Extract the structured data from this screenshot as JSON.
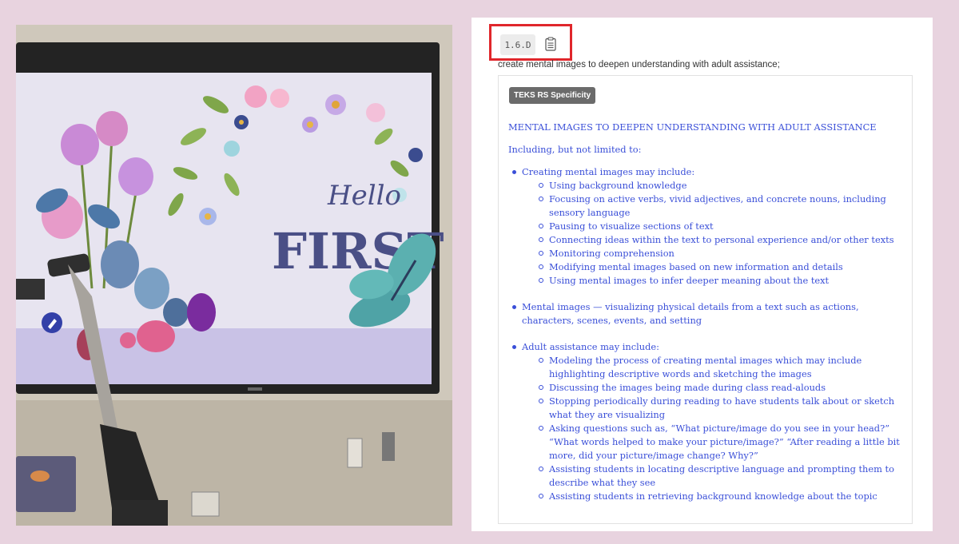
{
  "photo": {
    "screen_greeting": "Hello",
    "screen_title": "FIRST"
  },
  "panel": {
    "standard_code": "1.6.D",
    "copy_icon": "clipboard-icon",
    "description": "create mental images to deepen understanding with adult assistance;",
    "badge": "TEKS RS Specificity",
    "heading": "MENTAL IMAGES TO DEEPEN UNDERSTANDING WITH ADULT ASSISTANCE",
    "intro": "Including, but not limited to:",
    "sections": [
      {
        "label": "Creating mental images may include:",
        "items": [
          "Using background knowledge",
          "Focusing on active verbs, vivid adjectives, and concrete nouns, including sensory language",
          "Pausing to visualize sections of text",
          "Connecting ideas within the text to personal experience and/or other texts",
          "Monitoring comprehension",
          "Modifying mental images based on new information and details",
          "Using mental images to infer deeper meaning about the text"
        ]
      },
      {
        "label": "Mental images — visualizing physical details from a text such as actions, characters, scenes, events, and setting",
        "items": []
      },
      {
        "label": "Adult assistance may include:",
        "items": [
          "Modeling the process of creating mental images which may include highlighting descriptive words and sketching the images",
          "Discussing the images being made during class read-alouds",
          "Stopping periodically during reading to have students talk about or sketch what they are visualizing",
          "Asking questions such as, “What picture/image do you see in your head?” “What words helped to make your picture/image?” “After reading a little bit more, did your picture/image change? Why?”",
          "Assisting students in locating descriptive language and prompting them to describe what they see",
          "Assisting students in retrieving background knowledge about the topic"
        ]
      }
    ]
  },
  "colors": {
    "background": "#e8d3df",
    "link_text": "#3a4fd8",
    "highlight_box": "#e0262b",
    "badge_bg": "#6b6b6b"
  }
}
